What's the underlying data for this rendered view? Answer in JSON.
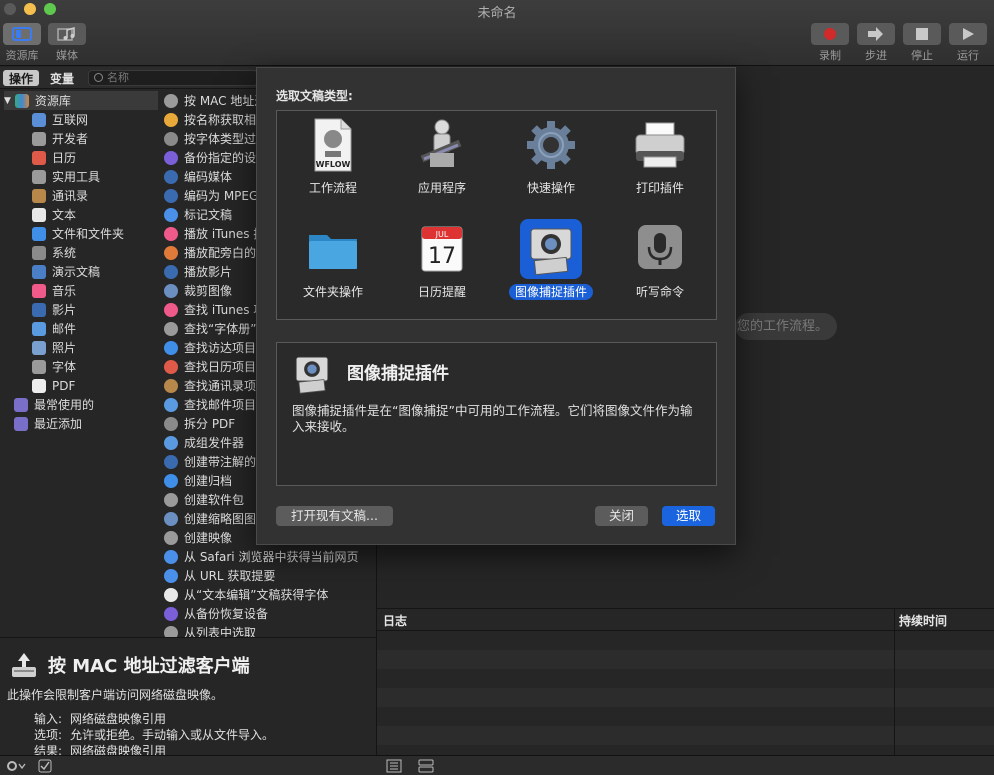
{
  "window": {
    "title": "未命名"
  },
  "toolbar": {
    "left": [
      {
        "label": "资源库",
        "icon": "library-icon"
      },
      {
        "label": "媒体",
        "icon": "media-icon"
      }
    ],
    "right": [
      {
        "label": "录制",
        "icon": "record-icon"
      },
      {
        "label": "步进",
        "icon": "step-icon"
      },
      {
        "label": "停止",
        "icon": "stop-icon"
      },
      {
        "label": "运行",
        "icon": "run-icon"
      }
    ]
  },
  "panes": {
    "tab_actions": "操作",
    "tab_variables": "变量",
    "search_placeholder": "名称"
  },
  "library": {
    "root": "资源库",
    "items": [
      "互联网",
      "开发者",
      "日历",
      "实用工具",
      "通讯录",
      "文本",
      "文件和文件夹",
      "系统",
      "演示文稿",
      "音乐",
      "影片",
      "邮件",
      "照片",
      "字体",
      "PDF"
    ],
    "smart": [
      "最常使用的",
      "最近添加"
    ]
  },
  "actions": [
    "按 MAC 地址过滤客户端",
    "按名称获取相册",
    "按字体类型过滤",
    "备份指定的设备",
    "编码媒体",
    "编码为 MPEG",
    "标记文稿",
    "播放 iTunes 播放列表",
    "播放配旁白的幻灯片",
    "播放影片",
    "裁剪图像",
    "查找 iTunes 项目",
    "查找“字体册”字体",
    "查找访达项目",
    "查找日历项目",
    "查找通讯录项目",
    "查找邮件项目",
    "拆分 PDF",
    "成组发件器",
    "创建带注解的影片",
    "创建归档",
    "创建软件包",
    "创建缩略图图像",
    "创建映像",
    "从 Safari 浏览器中获得当前网页",
    "从 URL 获取提要",
    "从“文本编辑”文稿获得字体",
    "从备份恢复设备",
    "从列表中选取"
  ],
  "description": {
    "title": "按 MAC 地址过滤客户端",
    "body": "此操作会限制客户端访问网络磁盘映像。",
    "input_label": "输入:",
    "input_value": "网络磁盘映像引用",
    "options_label": "选项:",
    "options_value": "允许或拒绝。手动输入或从文件导入。",
    "result_label": "结果:",
    "result_value": "网络磁盘映像引用"
  },
  "workflow": {
    "hint": "您的工作流程。"
  },
  "log": {
    "col_log": "日志",
    "col_duration": "持续时间"
  },
  "dialog": {
    "heading": "选取文稿类型:",
    "types": [
      {
        "label": "工作流程",
        "icon": "workflow-document-icon",
        "badge": "WFLOW"
      },
      {
        "label": "应用程序",
        "icon": "automator-robot-icon"
      },
      {
        "label": "快速操作",
        "icon": "gear-icon"
      },
      {
        "label": "打印插件",
        "icon": "printer-icon"
      },
      {
        "label": "文件夹操作",
        "icon": "folder-icon"
      },
      {
        "label": "日历提醒",
        "icon": "calendar-icon",
        "month": "JUL",
        "day": "17"
      },
      {
        "label": "图像捕捉插件",
        "icon": "image-capture-icon",
        "selected": true
      },
      {
        "label": "听写命令",
        "icon": "microphone-icon"
      }
    ],
    "info_title": "图像捕捉插件",
    "info_body": "图像捕捉插件是在“图像捕捉”中可用的工作流程。它们将图像文件作为输入来接收。",
    "btn_open": "打开现有文稿...",
    "btn_close": "关闭",
    "btn_choose": "选取",
    "accent": "#1b5fd6"
  }
}
